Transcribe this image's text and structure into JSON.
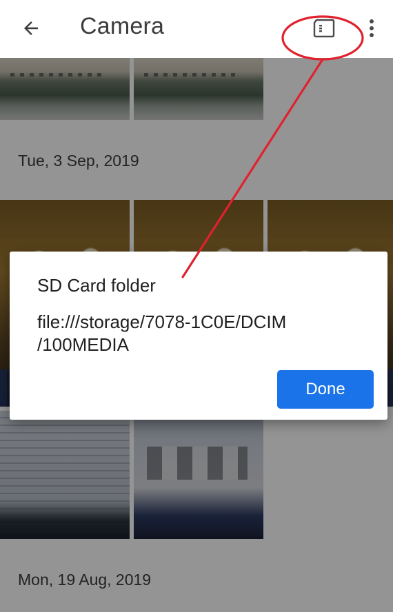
{
  "appbar": {
    "title": "Camera",
    "back_icon": "arrow-back-icon",
    "sd_card_icon": "sd-card-icon",
    "more_icon": "more-vert-icon"
  },
  "sections": [
    {
      "date": "Tue, 3 Sep, 2019"
    },
    {
      "date": "Mon, 19 Aug, 2019"
    }
  ],
  "dialog": {
    "title": "SD Card folder",
    "path": "file:///storage/7078-1C0E/DCIM /100MEDIA",
    "done_label": "Done"
  },
  "colors": {
    "accent": "#1a73e8",
    "annotation": "#e0212e",
    "scrim": "rgba(0,0,0,0.42)"
  }
}
